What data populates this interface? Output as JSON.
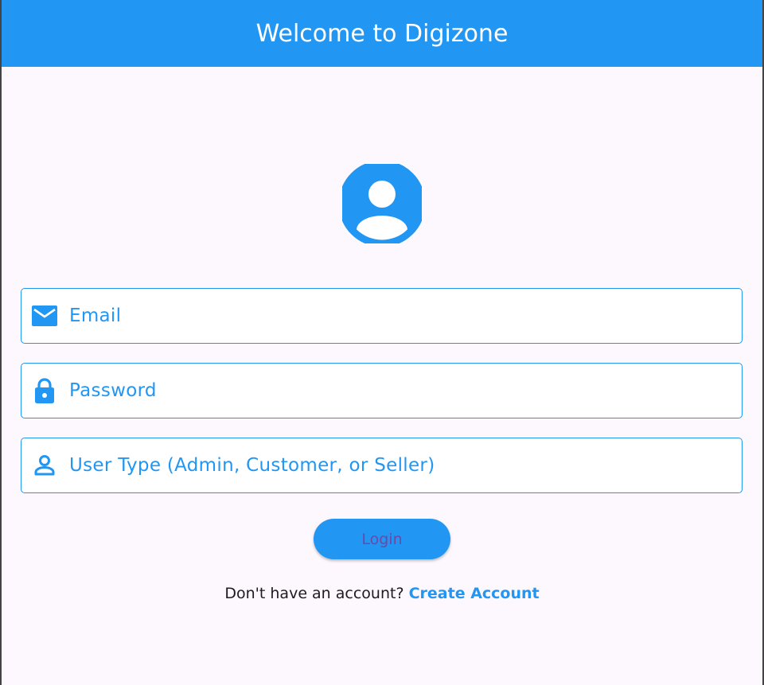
{
  "app": {
    "title": "Welcome to Digizone",
    "accent_color": "#2196f3",
    "background_color": "#fdf7fe"
  },
  "avatar": {
    "icon": "account-circle-icon"
  },
  "form": {
    "email": {
      "icon": "email-icon",
      "placeholder": "Email",
      "value": ""
    },
    "password": {
      "icon": "lock-icon",
      "placeholder": "Password",
      "value": ""
    },
    "user_type": {
      "icon": "person-icon",
      "placeholder": "User Type (Admin, Customer, or Seller)",
      "value": ""
    },
    "login_label": "Login"
  },
  "footer": {
    "prompt": "Don't have an account?",
    "link_label": "Create Account"
  }
}
